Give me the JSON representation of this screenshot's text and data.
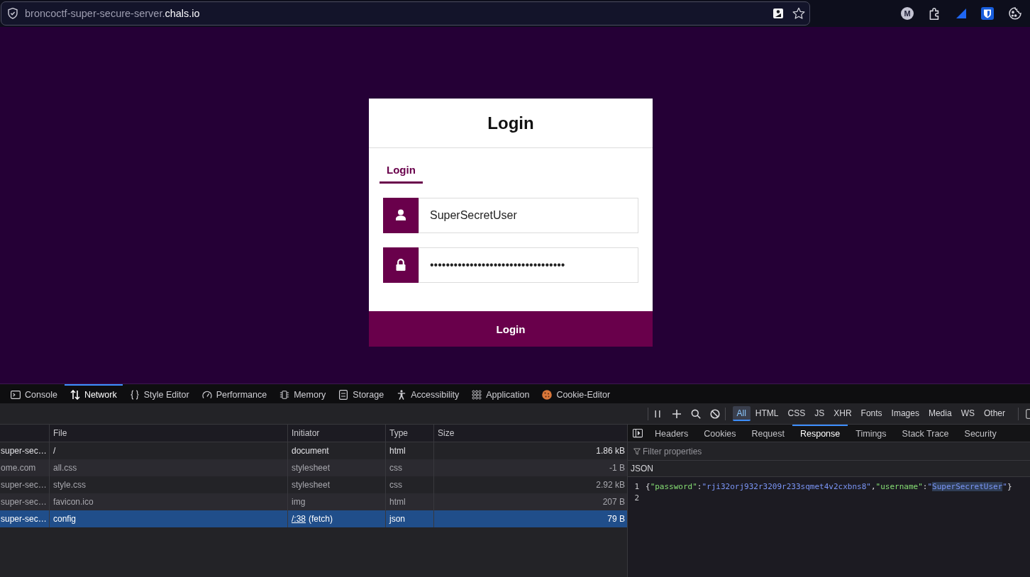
{
  "browser": {
    "url": {
      "subdomain": "broncoctf-super-secure-server.",
      "domain": "chals.io"
    },
    "account_initial": "M"
  },
  "login": {
    "title": "Login",
    "tabs": [
      {
        "label": "Login",
        "selected": true
      }
    ],
    "fields": [
      {
        "kind": "user",
        "value": "SuperSecretUser"
      },
      {
        "kind": "lock",
        "value": "••••••••••••••••••••••••••••••••••"
      }
    ],
    "submit": "Login"
  },
  "devtools": {
    "tabs": [
      {
        "label": "Console",
        "kind": "console",
        "selected": false
      },
      {
        "label": "Network",
        "kind": "network",
        "selected": true
      },
      {
        "label": "Style Editor",
        "kind": "style",
        "selected": false
      },
      {
        "label": "Performance",
        "kind": "performance",
        "selected": false
      },
      {
        "label": "Memory",
        "kind": "memory",
        "selected": false
      },
      {
        "label": "Storage",
        "kind": "storage",
        "selected": false
      },
      {
        "label": "Accessibility",
        "kind": "accessibility",
        "selected": false
      },
      {
        "label": "Application",
        "kind": "application",
        "selected": false
      },
      {
        "label": "Cookie-Editor",
        "kind": "cookie",
        "selected": false
      }
    ],
    "toolbar": {
      "filters": [
        {
          "label": "All",
          "selected": true
        },
        {
          "label": "HTML",
          "selected": false
        },
        {
          "label": "CSS",
          "selected": false
        },
        {
          "label": "JS",
          "selected": false
        },
        {
          "label": "XHR",
          "selected": false
        },
        {
          "label": "Fonts",
          "selected": false
        },
        {
          "label": "Images",
          "selected": false
        },
        {
          "label": "Media",
          "selected": false
        },
        {
          "label": "WS",
          "selected": false
        },
        {
          "label": "Other",
          "selected": false
        }
      ],
      "checkbox": {
        "checked": false
      }
    },
    "network": {
      "columns": [
        "File",
        "Initiator",
        "Type",
        "Size"
      ],
      "rows": [
        {
          "column_1": "super-sec…",
          "file": "/",
          "initiator": "document",
          "type": "html",
          "size": "1.86 kB",
          "dimmed": false,
          "selected": false
        },
        {
          "column_1": "ome.com",
          "file": "all.css",
          "initiator": "stylesheet",
          "type": "css",
          "size": "-1 B",
          "dimmed": true,
          "selected": false
        },
        {
          "column_1": "super-sec…",
          "file": "style.css",
          "initiator": "stylesheet",
          "type": "css",
          "size": "2.92 kB",
          "dimmed": true,
          "selected": false
        },
        {
          "column_1": "super-sec…",
          "file": "favicon.ico",
          "initiator": "img",
          "type": "html",
          "size": "207 B",
          "dimmed": true,
          "selected": false
        },
        {
          "column_1": "super-sec…",
          "file": "config",
          "initiator_link": "/:38",
          "initiator": "(fetch)",
          "type": "json",
          "size": "79 B",
          "dimmed": false,
          "selected": true
        }
      ]
    },
    "details": {
      "tabs": [
        {
          "label": "Headers",
          "selected": false
        },
        {
          "label": "Cookies",
          "selected": false
        },
        {
          "label": "Request",
          "selected": false
        },
        {
          "label": "Response",
          "selected": true
        },
        {
          "label": "Timings",
          "selected": false
        },
        {
          "label": "Stack Trace",
          "selected": false
        },
        {
          "label": "Security",
          "selected": false
        }
      ],
      "filter": {
        "placeholder": "Filter properties"
      },
      "section": "JSON",
      "lines": [
        {
          "number": "1",
          "tokens": [
            {
              "text": "{",
              "kind": "punct",
              "highlighted": false
            },
            {
              "text": "\"password\"",
              "kind": "key",
              "highlighted": false
            },
            {
              "text": ":",
              "kind": "punct",
              "highlighted": false
            },
            {
              "text": "\"rji32orj932r3209r233sqmet4v2cxbns8\"",
              "kind": "string",
              "highlighted": false
            },
            {
              "text": ",",
              "kind": "punct",
              "highlighted": false
            },
            {
              "text": "\"username\"",
              "kind": "key",
              "highlighted": false
            },
            {
              "text": ":",
              "kind": "punct",
              "highlighted": false
            },
            {
              "text": "\"",
              "kind": "string",
              "highlighted": false
            },
            {
              "text": "SuperSecretUser",
              "kind": "string",
              "highlighted": true
            },
            {
              "text": "\"",
              "kind": "string",
              "highlighted": false
            },
            {
              "text": "}",
              "kind": "punct",
              "highlighted": false
            }
          ]
        },
        {
          "number": "2"
        }
      ]
    }
  }
}
